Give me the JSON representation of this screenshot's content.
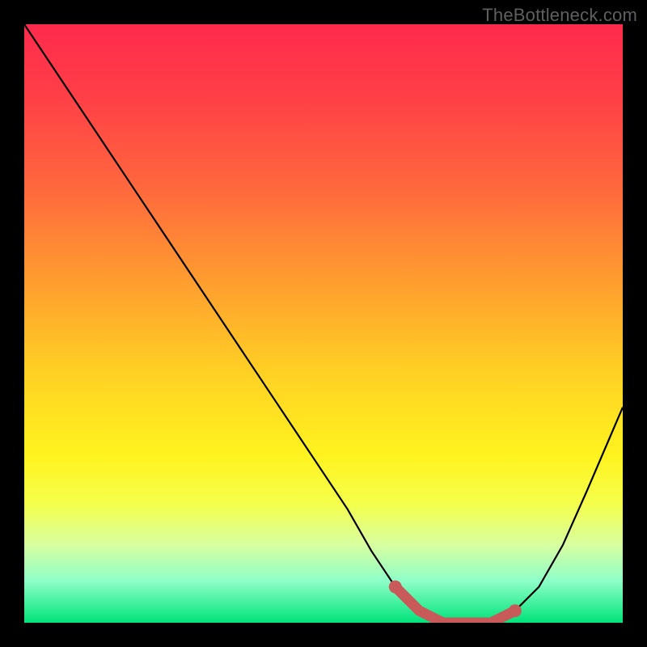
{
  "watermark": "TheBottleneck.com",
  "chart_data": {
    "type": "line",
    "title": "",
    "xlabel": "",
    "ylabel": "",
    "xlim": [
      0,
      100
    ],
    "ylim": [
      0,
      100
    ],
    "series": [
      {
        "name": "bottleneck-curve",
        "x": [
          0,
          6,
          12,
          18,
          24,
          30,
          36,
          42,
          48,
          54,
          58,
          62,
          66,
          70,
          74,
          78,
          82,
          86,
          90,
          94,
          100
        ],
        "values": [
          100,
          91,
          82,
          73,
          64,
          55,
          46,
          37,
          28,
          19,
          12,
          6,
          2,
          0,
          0,
          0,
          2,
          6,
          13,
          22,
          36
        ]
      }
    ],
    "highlight_segment": {
      "name": "optimal-range",
      "x": [
        62,
        66,
        70,
        74,
        78,
        82
      ],
      "values": [
        6,
        2,
        0,
        0,
        0,
        2
      ],
      "color": "#c95a5a"
    },
    "gradient_stops": [
      {
        "pos": 0,
        "color": "#ff2a4d"
      },
      {
        "pos": 28,
        "color": "#ff6a3d"
      },
      {
        "pos": 58,
        "color": "#ffd024"
      },
      {
        "pos": 80,
        "color": "#f5ff4a"
      },
      {
        "pos": 100,
        "color": "#00e37a"
      }
    ]
  }
}
